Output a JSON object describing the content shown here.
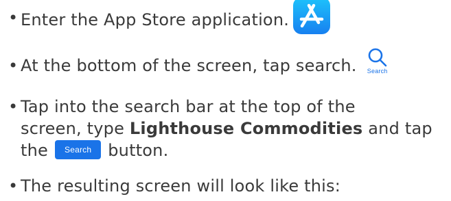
{
  "steps": [
    {
      "text": "Enter the App Store application.",
      "icon": "app-store-icon"
    },
    {
      "text": "At the bottom of the screen, tap search.",
      "icon": "search-tab-icon",
      "icon_label": "Search"
    },
    {
      "line1": "Tap into the search bar at the top of the",
      "line2_prefix": "screen, type",
      "line2_bold": "Lighthouse Commodities",
      "line2_suffix": "and tap",
      "line3_prefix": "the",
      "button_label": "Search",
      "line3_suffix": "button."
    },
    {
      "text": "The resulting screen will look like this:"
    }
  ],
  "bullet": "•",
  "colors": {
    "text": "#3a3a3a",
    "accent": "#1a73e8",
    "appstore_top": "#1ec3fb",
    "appstore_bottom": "#1780f0"
  }
}
